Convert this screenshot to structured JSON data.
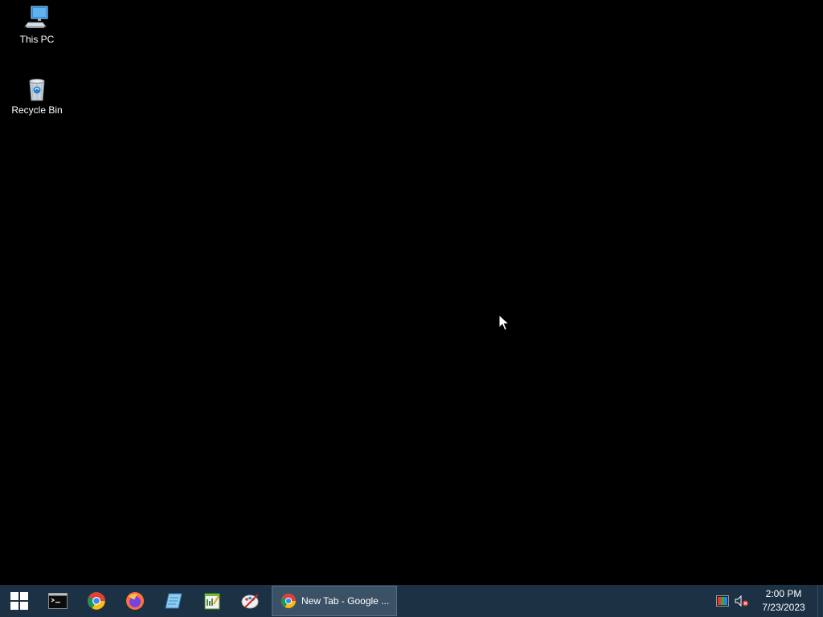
{
  "desktop": {
    "icons": [
      {
        "label": "This PC",
        "icon": "computer-icon"
      },
      {
        "label": "Recycle Bin",
        "icon": "recycle-bin-icon"
      }
    ]
  },
  "taskbar": {
    "start_icon": "windows-logo-icon",
    "pinned": [
      {
        "name": "Command Prompt",
        "icon": "command-prompt-icon"
      },
      {
        "name": "Google Chrome",
        "icon": "chrome-icon"
      },
      {
        "name": "Firefox",
        "icon": "firefox-icon"
      },
      {
        "name": "Notepad",
        "icon": "notepad-icon"
      },
      {
        "name": "Text Editor",
        "icon": "text-editor-icon"
      },
      {
        "name": "Paint",
        "icon": "paint-icon"
      }
    ],
    "active_window": {
      "label": "New Tab - Google ...",
      "icon": "chrome-icon"
    },
    "tray": {
      "icons": [
        "color-display-icon",
        "speaker-muted-icon"
      ],
      "time": "2:00 PM",
      "date": "7/23/2023"
    }
  },
  "colors": {
    "desktop_background": "#000000",
    "taskbar": "#1c3144",
    "active_task": "#3b5266"
  }
}
